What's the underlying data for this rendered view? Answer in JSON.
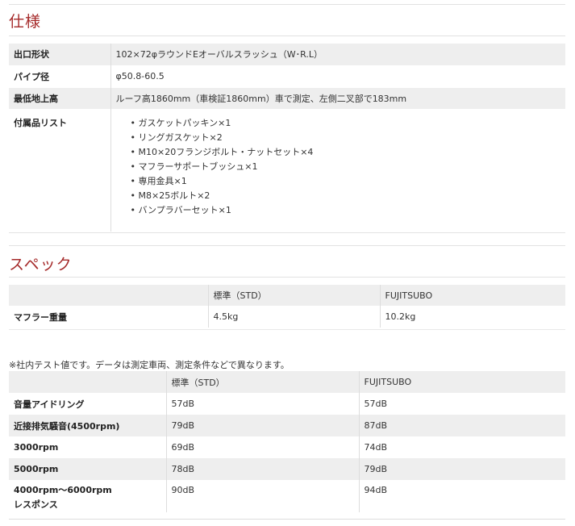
{
  "sections": {
    "spec_title": "仕様",
    "performance_title": "スペック"
  },
  "spec": {
    "rows": [
      {
        "label": "出口形状",
        "value": "102×72φラウンドEオーバルスラッシュ（W･R.L）"
      },
      {
        "label": "パイプ径",
        "value": "φ50.8-60.5"
      },
      {
        "label": "最低地上高",
        "value": "ルーフ高1860mm（車検証1860mm）車で測定、左側二叉部で183mm"
      },
      {
        "label": "付属品リスト",
        "value": ""
      }
    ],
    "parts": [
      "ガスケットパッキン×1",
      "リングガスケット×2",
      "M10×20フランジボルト・ナットセット×4",
      "マフラーサポートブッシュ×1",
      "専用金具×1",
      "M8×25ボルト×2",
      "バンプラバーセット×1"
    ]
  },
  "weight": {
    "headers": [
      "",
      "標準（STD）",
      "FUJITSUBO"
    ],
    "row": {
      "label": "マフラー重量",
      "std": "4.5kg",
      "fujitsubo": "10.2kg"
    }
  },
  "note": "※社内テスト値です。データは測定車両、測定条件などで異なります。",
  "sound": {
    "headers": [
      "",
      "標準（STD）",
      "FUJITSUBO"
    ],
    "rows": [
      {
        "label": "音量アイドリング",
        "std": "57dB",
        "fujitsubo": "57dB"
      },
      {
        "label": "近接排気騒音(4500rpm)",
        "std": "79dB",
        "fujitsubo": "87dB"
      },
      {
        "label": "3000rpm",
        "std": "69dB",
        "fujitsubo": "74dB"
      },
      {
        "label": "5000rpm",
        "std": "78dB",
        "fujitsubo": "79dB"
      },
      {
        "label_line1": "4000rpm～6000rpm",
        "label_line2": "レスポンス",
        "std": "90dB",
        "fujitsubo": "94dB"
      }
    ]
  },
  "colors": {
    "title": "#a52a2a",
    "shade": "#eeeeee",
    "border": "#dddddd"
  }
}
